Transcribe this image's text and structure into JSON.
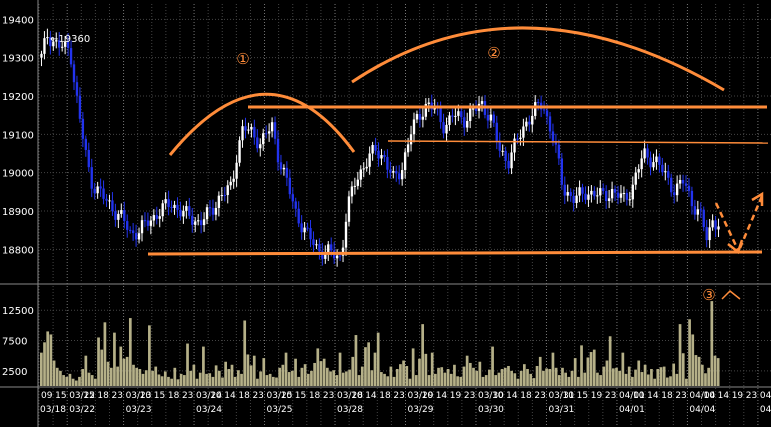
{
  "chart_data": [
    {
      "type": "candlestick",
      "title": "",
      "ylim": [
        18720,
        19440
      ],
      "y_ticks": [
        "19400",
        "19300",
        "19200",
        "19100",
        "19000",
        "18900",
        "18800"
      ],
      "y_tick_values": [
        19400,
        19300,
        19200,
        19100,
        19000,
        18900,
        18800
      ],
      "grid": true,
      "max_annotation": "←19360",
      "max_value": 19360,
      "candle_up_color": "#ffffff",
      "candle_down_color": "#2233ee",
      "close_path": [
        [
          0,
          19300
        ],
        [
          4,
          19360
        ],
        [
          12,
          19330
        ],
        [
          20,
          19320
        ],
        [
          26,
          19150
        ],
        [
          34,
          18980
        ],
        [
          44,
          18930
        ],
        [
          56,
          18880
        ],
        [
          62,
          18840
        ],
        [
          68,
          18850
        ],
        [
          74,
          18870
        ],
        [
          82,
          18900
        ],
        [
          90,
          18920
        ],
        [
          100,
          18890
        ],
        [
          110,
          18870
        ],
        [
          118,
          18900
        ],
        [
          124,
          18940
        ],
        [
          132,
          18960
        ],
        [
          136,
          19060
        ],
        [
          140,
          19120
        ],
        [
          146,
          19100
        ],
        [
          152,
          19080
        ],
        [
          160,
          19120
        ],
        [
          164,
          19050
        ],
        [
          170,
          18980
        ],
        [
          176,
          18900
        ],
        [
          184,
          18840
        ],
        [
          192,
          18800
        ],
        [
          200,
          18790
        ],
        [
          208,
          18780
        ],
        [
          212,
          18900
        ],
        [
          218,
          18980
        ],
        [
          224,
          19020
        ],
        [
          232,
          19060
        ],
        [
          238,
          19040
        ],
        [
          244,
          18980
        ],
        [
          250,
          19010
        ],
        [
          256,
          19100
        ],
        [
          262,
          19150
        ],
        [
          268,
          19180
        ],
        [
          274,
          19160
        ],
        [
          280,
          19120
        ],
        [
          286,
          19150
        ],
        [
          294,
          19140
        ],
        [
          300,
          19160
        ],
        [
          306,
          19180
        ],
        [
          312,
          19140
        ],
        [
          318,
          19060
        ],
        [
          324,
          19030
        ],
        [
          330,
          19080
        ],
        [
          336,
          19130
        ],
        [
          342,
          19160
        ],
        [
          348,
          19180
        ],
        [
          356,
          19080
        ],
        [
          362,
          18960
        ],
        [
          370,
          18930
        ],
        [
          378,
          18950
        ],
        [
          388,
          18940
        ],
        [
          396,
          18950
        ],
        [
          404,
          18930
        ],
        [
          410,
          18960
        ],
        [
          418,
          19050
        ],
        [
          426,
          19030
        ],
        [
          434,
          18990
        ],
        [
          440,
          18950
        ],
        [
          446,
          18980
        ],
        [
          452,
          18920
        ],
        [
          458,
          18880
        ],
        [
          462,
          18830
        ],
        [
          466,
          18880
        ],
        [
          470,
          18860
        ]
      ],
      "volume": {
        "ylim": [
          0,
          15500
        ],
        "y_ticks": [
          "12500",
          "7500",
          "2500"
        ],
        "y_tick_values": [
          12500,
          7500,
          2500
        ],
        "bar_color": "#b5b088",
        "bars": [
          5500,
          7200,
          9000,
          8500,
          4200,
          3000,
          2500,
          1800,
          1500,
          2000,
          1200,
          900,
          1500,
          2800,
          5000,
          2200,
          1800,
          1200,
          8000,
          6000,
          10500,
          4000,
          3000,
          8800,
          3200,
          6500,
          4500,
          4800,
          11200,
          3500,
          3000,
          2800,
          2000,
          2600,
          10000,
          2500,
          3200,
          1900,
          1600,
          2400,
          1500,
          1200,
          3000,
          1100,
          2000,
          1800,
          7000,
          2500,
          3500,
          1200,
          2200,
          6500,
          2000,
          2100,
          1500,
          3400,
          2500,
          1400,
          4000,
          2800,
          3500,
          1500,
          2600,
          2000,
          10800,
          5200,
          3400,
          5000,
          1200,
          2400,
          4600,
          1800,
          2000,
          1500,
          1400,
          3000,
          3500,
          5500,
          2300,
          2500,
          4500,
          1500,
          3000,
          3600,
          2000,
          2500,
          3800,
          6200,
          4100,
          4500,
          3000,
          2400,
          2600,
          1800,
          5500,
          2200,
          2400,
          2700,
          4800,
          8400,
          1800,
          3200,
          6400,
          7200,
          2600,
          5500,
          8800,
          2300,
          2000,
          1600,
          3200,
          1500,
          2800,
          3600,
          4200,
          3300,
          1200,
          6200,
          1800,
          4500,
          10200,
          5300,
          1800,
          5500,
          2000,
          3000,
          3100,
          2200,
          2800,
          2000,
          3500,
          1600,
          1500,
          3200,
          5000,
          3800,
          3000,
          2500,
          4000,
          1500,
          1800,
          2700,
          6500,
          1800,
          2200,
          2800,
          3000,
          3300,
          2500,
          2100,
          1200,
          2500,
          3600,
          2800,
          2000,
          1300,
          3300,
          4800,
          2500,
          2900,
          2800,
          5500,
          3000,
          1800,
          3000,
          2200,
          1500,
          2500,
          4600,
          1500,
          6700,
          2200,
          4700,
          5600,
          6000,
          2200,
          1800,
          3200,
          4200,
          8200,
          2900,
          3000,
          2500,
          5500,
          2000,
          3200,
          1500,
          2700,
          4200,
          2300,
          3500,
          1900,
          2800,
          1200,
          2800,
          3100,
          3200,
          1400,
          1600,
          3700,
          2000,
          10200,
          5400,
          1200,
          11000,
          8500,
          5100,
          4800,
          3500,
          2100,
          3000,
          14000,
          5000,
          4600
        ]
      },
      "x_ticks": [
        "09",
        "15",
        "03/22",
        "15",
        "18",
        "23",
        "03/23",
        "10",
        "15",
        "18",
        "23",
        "03/24",
        "10",
        "14",
        "18",
        "23",
        "03/25",
        "10",
        "15",
        "18",
        "23",
        "03/28",
        "10",
        "14",
        "18",
        "23",
        "03/29",
        "10",
        "14",
        "19",
        "23",
        "03/30",
        "10",
        "14",
        "18",
        "23",
        "03/31",
        "10",
        "15",
        "19",
        "23",
        "04/01",
        "10",
        "14",
        "18",
        "23",
        "04/04",
        "10",
        "14",
        "19",
        "23",
        "04/"
      ],
      "x_date_labels": [
        "03/18",
        "03/22",
        "03/23",
        "03/24",
        "03/25",
        "03/28",
        "03/29",
        "03/30",
        "03/31",
        "04/01",
        "04/04",
        "04/"
      ],
      "annotations": [
        {
          "label": "①",
          "kind": "arc-peak"
        },
        {
          "label": "②",
          "kind": "arc-peak"
        },
        {
          "label": "③",
          "kind": "volume-marker"
        }
      ],
      "support_resistance_levels": [
        19165,
        19070,
        18765
      ],
      "annotation_color": "#ff8c3a"
    }
  ]
}
